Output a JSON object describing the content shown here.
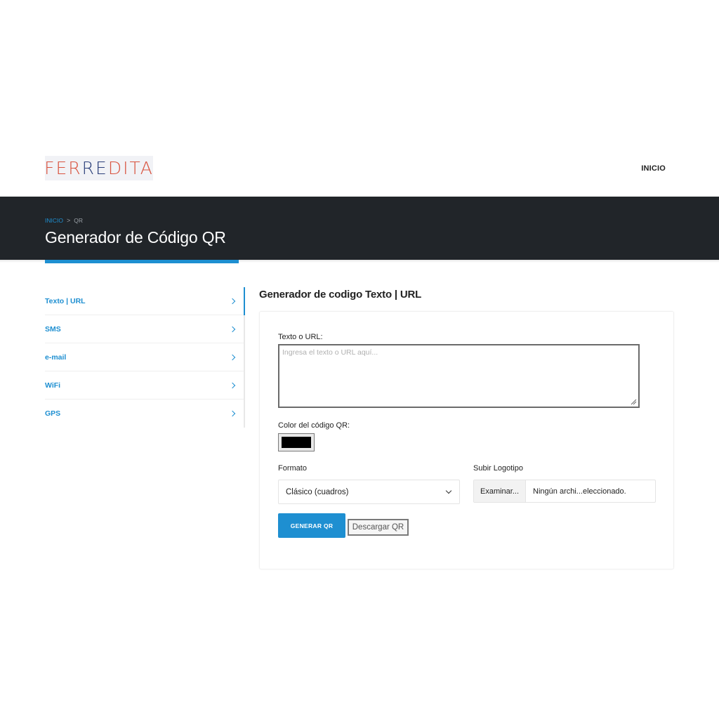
{
  "header": {
    "logo_text": "FERREDITA",
    "nav": {
      "inicio_label": "INICIO"
    }
  },
  "band": {
    "breadcrumb": {
      "home_label": "INICIO",
      "separator": ">",
      "current": "QR"
    },
    "title": "Generador de Código QR"
  },
  "sidebar": {
    "items": [
      {
        "label": "Texto | URL",
        "active": true
      },
      {
        "label": "SMS"
      },
      {
        "label": "e-mail"
      },
      {
        "label": "WiFi"
      },
      {
        "label": "GPS"
      }
    ]
  },
  "main": {
    "section_title": "Generador de codigo Texto | URL",
    "form": {
      "text_label": "Texto o URL:",
      "text_placeholder": "Ingresa el texto o URL aquí...",
      "color_label": "Color del código QR:",
      "color_value": "#000000",
      "format_label": "Formato",
      "format_selected": "Clásico (cuadros)",
      "logo_label": "Subir Logotipo",
      "file_button": "Examinar...",
      "file_status": "Ningún archi...eleccionado.",
      "generate_button": "GENERAR QR",
      "download_button": "Descargar QR"
    }
  },
  "colors": {
    "accent": "#1e8fd1",
    "band_bg": "#212529",
    "logo_red": "#d9533f",
    "logo_blue": "#2b3f7a"
  }
}
